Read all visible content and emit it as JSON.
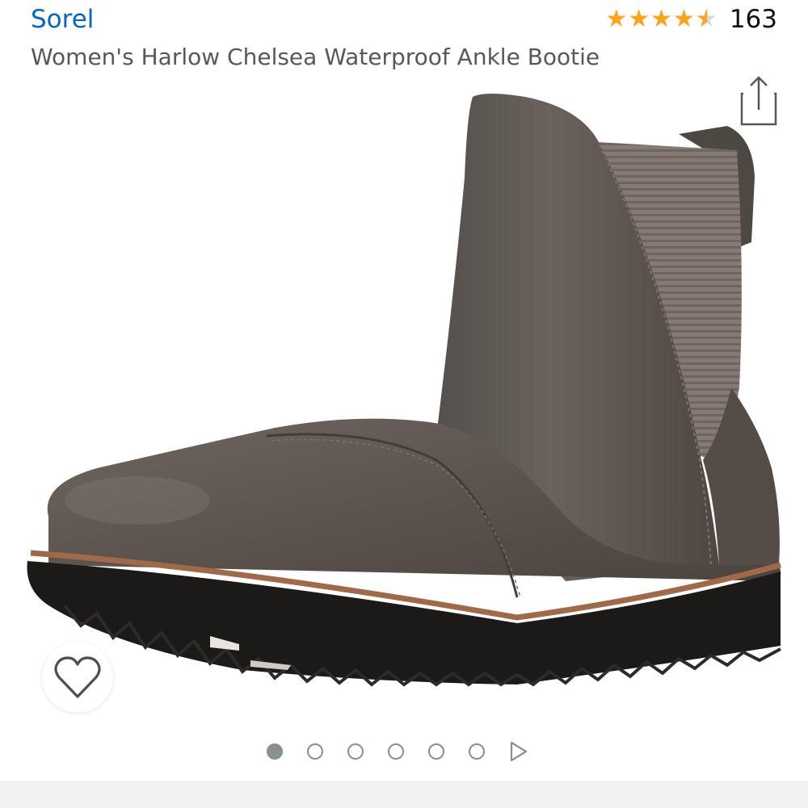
{
  "product": {
    "brand": "Sorel",
    "title": "Women's Harlow Chelsea Waterproof Ankle Bootie",
    "rating_stars": "★★★★★",
    "rating_value": 0.9,
    "rating_count": "163"
  },
  "gallery": {
    "image_count": 6,
    "active_index": 0
  },
  "colors": {
    "brand_link": "#0066c0",
    "star_fill": "#ffa41c",
    "title_text": "#565959",
    "boot_leather": "#5e5650",
    "sole": "#1c1a19",
    "welt": "#a06a48"
  },
  "icons": {
    "share": "share-icon",
    "wishlist": "heart-outline-icon",
    "next": "play-triangle-icon"
  }
}
